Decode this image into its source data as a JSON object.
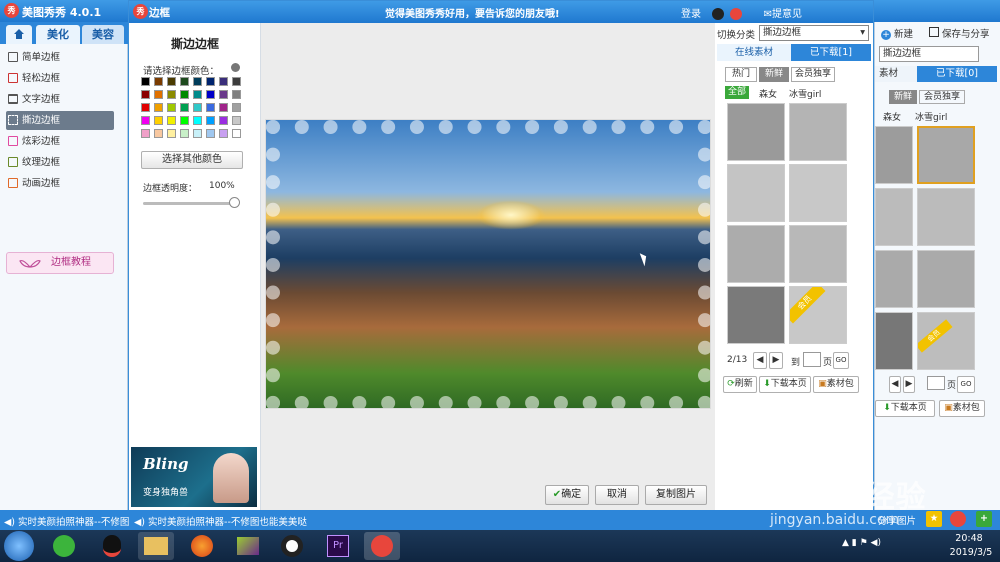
{
  "main_window": {
    "title": "美图秀秀 4.0.1",
    "logo": "秀",
    "tabs": [
      "美化",
      "美容"
    ],
    "nav_items": [
      {
        "label": "简单边框",
        "icon": "square-icon"
      },
      {
        "label": "轻松边框",
        "icon": "frame-icon"
      },
      {
        "label": "文字边框",
        "icon": "text-frame-icon"
      },
      {
        "label": "撕边边框",
        "icon": "torn-frame-icon",
        "active": true
      },
      {
        "label": "炫彩边框",
        "icon": "color-frame-icon"
      },
      {
        "label": "纹理边框",
        "icon": "texture-frame-icon"
      },
      {
        "label": "动画边框",
        "icon": "animation-frame-icon"
      }
    ],
    "tutorial_label": "边框教程",
    "right": {
      "new_label": "新建",
      "save_label": "保存与分享",
      "category_value": "撕边边框",
      "tab_online": "素材",
      "tab_downloaded": "已下载[0]",
      "filters": [
        "新鲜",
        "会员独享"
      ],
      "subfilters": [
        "森女",
        "冰雪girl"
      ],
      "page_go": "GO",
      "page_to": "页",
      "download_page": "下载本页",
      "material_pack": "素材包",
      "vip": "会员",
      "share_image": "分享图片"
    }
  },
  "dialog": {
    "logo": "秀",
    "title": "边框",
    "slogan": "觉得美图秀秀好用，要告诉您的朋友哦!",
    "login": "登录",
    "feedback": "提意见",
    "left": {
      "title": "撕边边框",
      "color_label": "请选择边框颜色：",
      "other_color": "选择其他颜色",
      "opacity_label": "边框透明度：",
      "opacity_value": "100%",
      "opacity": 1.0,
      "ad_title": "Bling",
      "ad_sub": "变身独角兽"
    },
    "bottom": {
      "ok": "确定",
      "cancel": "取消",
      "copy": "复制图片"
    },
    "right": {
      "switch_label": "切换分类",
      "category_value": "撕边边框",
      "tab_online": "在线素材",
      "tab_downloaded": "已下载[1]",
      "filters": [
        "热门",
        "新鲜",
        "会员独享"
      ],
      "subfilters": [
        "全部",
        "森女",
        "冰雪girl"
      ],
      "page_info": "2/13",
      "page_to": "到",
      "page_unit": "页",
      "page_go": "GO",
      "refresh": "刷新",
      "download_page": "下载本页",
      "material_pack": "素材包",
      "vip": "会员"
    }
  },
  "palette": [
    "#000000",
    "#7a3b00",
    "#4a3b00",
    "#1e4a1e",
    "#003c5a",
    "#00246e",
    "#3a2e7a",
    "#3c3c3c",
    "#8b0000",
    "#e07000",
    "#8a8a00",
    "#008a00",
    "#008a8a",
    "#0000c8",
    "#6a3a8a",
    "#808080",
    "#e00000",
    "#f0a000",
    "#a0c800",
    "#00a050",
    "#30c8c8",
    "#3a6ae0",
    "#a0248a",
    "#a0a0a0",
    "#f000f0",
    "#ffd000",
    "#f0f000",
    "#00ff00",
    "#00ffff",
    "#00a0ff",
    "#9a2ee0",
    "#c8c8c8",
    "#f0a0c8",
    "#f8c8a0",
    "#fff0a0",
    "#c8f0c8",
    "#c8f0f8",
    "#a0c8f0",
    "#c8a0f0",
    "#ffffff"
  ],
  "statusbar": {
    "left_text": "实时美颜拍照神器--不修图",
    "center_text": "实时美颜拍照神器--不修图也能美美哒"
  },
  "taskbar": {
    "time": "20:48",
    "date": "2019/3/5"
  },
  "watermark": {
    "text": "Baidu 经验",
    "url": "jingyan.baidu.com"
  }
}
